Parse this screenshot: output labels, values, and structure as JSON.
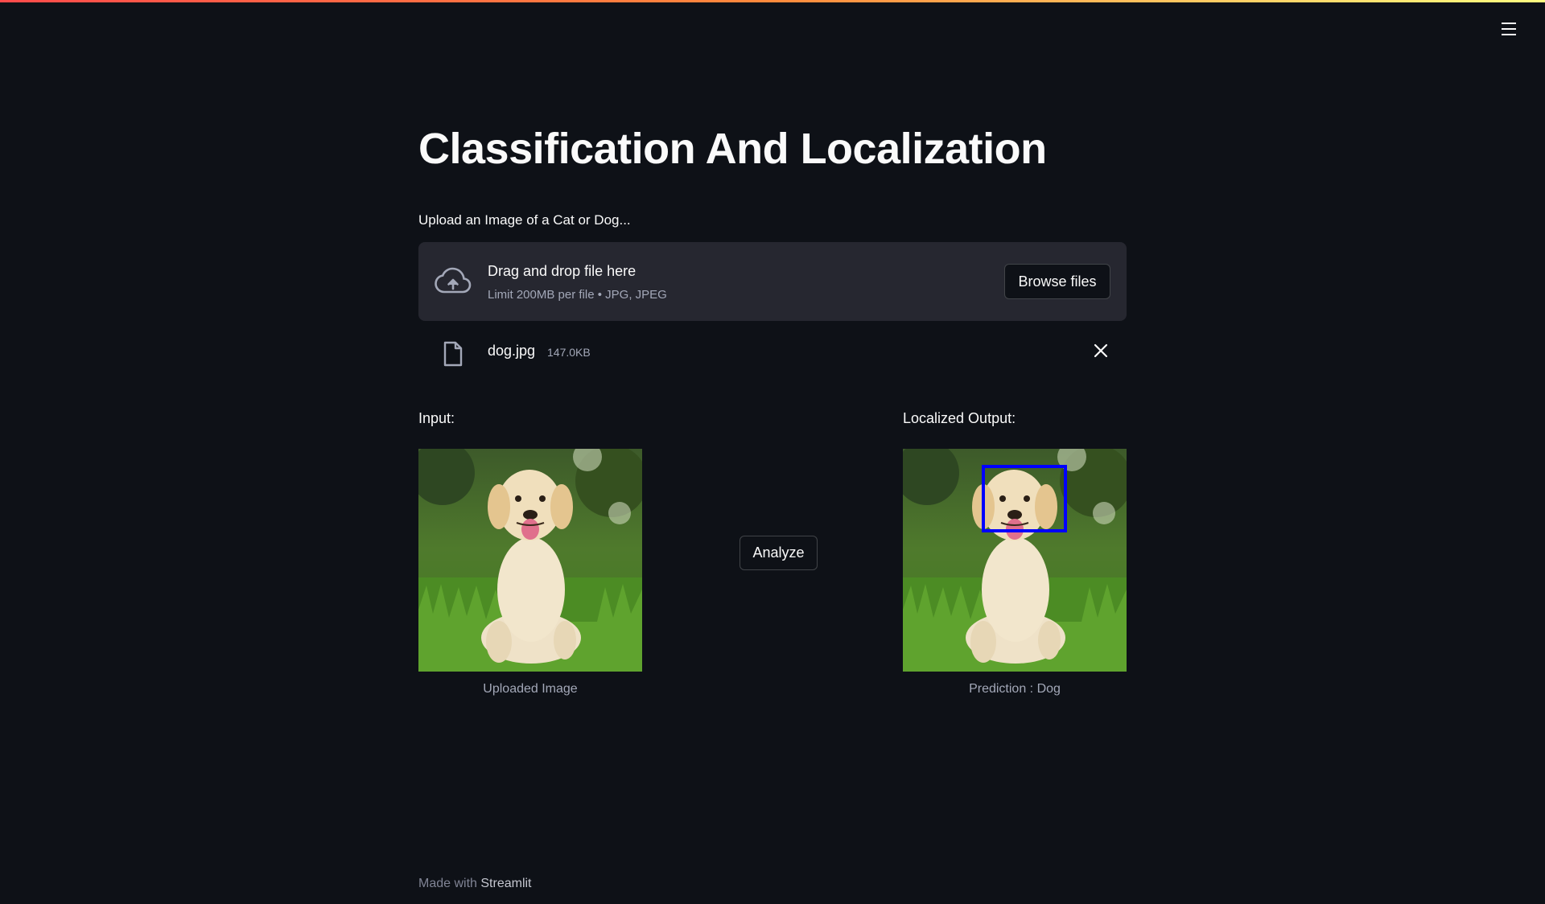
{
  "app": {
    "title": "Classification And Localization",
    "menu_icon": "hamburger-menu-icon"
  },
  "uploader": {
    "label": "Upload an Image of a Cat or Dog...",
    "drop_title": "Drag and drop file here",
    "drop_subtitle": "Limit 200MB per file • JPG, JPEG",
    "browse_label": "Browse files",
    "icon": "cloud-upload-icon"
  },
  "file": {
    "name": "dog.jpg",
    "size": "147.0KB",
    "icon": "file-icon",
    "remove_icon": "close-icon"
  },
  "input_column": {
    "label": "Input:",
    "caption": "Uploaded Image"
  },
  "analyze": {
    "label": "Analyze"
  },
  "output_column": {
    "label": "Localized Output:",
    "caption": "Prediction : Dog",
    "box_color": "#0000ff"
  },
  "footer": {
    "prefix": "Made with",
    "brand": "Streamlit"
  },
  "colors": {
    "background": "#0e1117",
    "surface": "#262730",
    "text": "#fafafa",
    "muted": "#a3a8b8"
  }
}
